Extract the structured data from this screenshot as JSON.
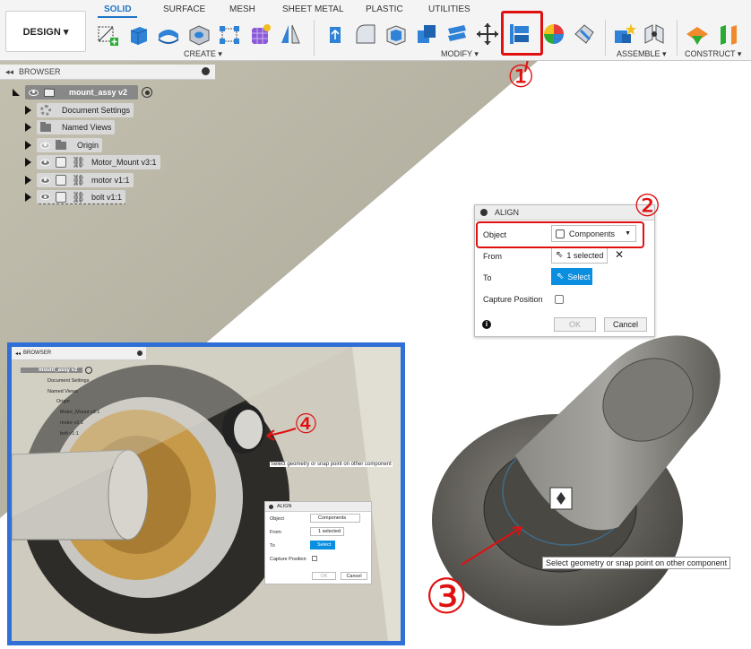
{
  "toolbar": {
    "design_label": "DESIGN ▾",
    "tabs": [
      "SOLID",
      "SURFACE",
      "MESH",
      "SHEET METAL",
      "PLASTIC",
      "UTILITIES"
    ],
    "groups": {
      "create": "CREATE ▾",
      "modify": "MODIFY ▾",
      "assemble": "ASSEMBLE ▾",
      "construct": "CONSTRUCT ▾"
    }
  },
  "browser": {
    "title": "BROWSER",
    "root": "mount_assy v2",
    "items": [
      "Document Settings",
      "Named Views",
      "Origin",
      "Motor_Mount v3:1",
      "motor v1:1",
      "bolt v1:1"
    ]
  },
  "align": {
    "title": "ALIGN",
    "object_label": "Object",
    "object_value": "Components",
    "from_label": "From",
    "from_value": "1 selected",
    "to_label": "To",
    "to_value": "Select",
    "capture_label": "Capture Position",
    "ok_label": "OK",
    "cancel_label": "Cancel"
  },
  "tooltip_text": "Select geometry or snap point on other component",
  "annotations": {
    "n1": "①",
    "n2": "②",
    "n3": "③",
    "n4": "④"
  },
  "colors": {
    "accent": "#1d74c6",
    "annotation_red": "#e01010",
    "inset_border": "#2f6fd6",
    "select_blue": "#0a8fe0",
    "brass": "#c79a4a"
  }
}
